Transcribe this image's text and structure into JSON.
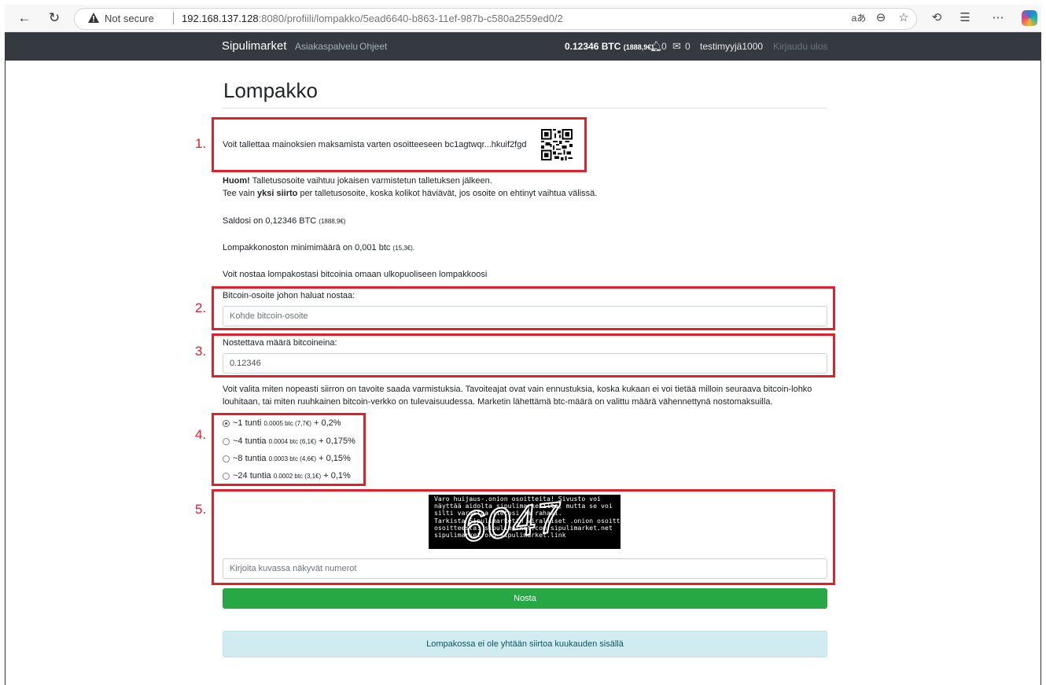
{
  "browser": {
    "not_secure": "Not secure",
    "url_host": "192.168.137.128",
    "url_rest": ":8080/profiili/lompakko/5ead6640-b863-11ef-987b-c580a2559ed0/2"
  },
  "site_nav": {
    "brand": "Sipulimarket",
    "link_customer_service": "Asiakaspalvelu",
    "link_help": "Ohjeet",
    "balance_btc": "0.12346 BTC",
    "balance_eur": "(1888,9€)",
    "notifications_count": "0",
    "messages_count": "0",
    "username": "testimyyjä1000",
    "logout": "Kirjaudu ulos"
  },
  "page": {
    "title": "Lompakko"
  },
  "annotations": {
    "n1": "1.",
    "n2": "2.",
    "n3": "3.",
    "n4": "4.",
    "n5": "5.",
    "color": "#e0202a"
  },
  "deposit": {
    "text": "Voit tallettaa mainoksien maksamista varten osoitteeseen bc1agtwqr...hkuif2fgd"
  },
  "notice": {
    "bold1": "Huom!",
    "line1_rest": " Talletusosoite vaihtuu jokaisen varmistetun talletuksen jälkeen.",
    "line2_a": "Tee vain ",
    "line2_bold": "yksi siirto",
    "line2_b": " per talletusosoite, koska kolikot häviävät, jos osoite on ehtinyt vaihtua välissä."
  },
  "balance": {
    "text": "Saldosi on 0,12346 BTC",
    "eur": "(1888,9€)"
  },
  "minimum": {
    "text": "Lompakkonoston minimimäärä on 0,001 btc",
    "eur": "(15,3€)."
  },
  "withdraw_intro": "Voit nostaa lompakostasi bitcoinia omaan ulkopuoliseen lompakkoosi",
  "address_field": {
    "label": "Bitcoin-osoite johon haluat nostaa:",
    "placeholder": "Kohde bitcoin-osoite"
  },
  "amount_field": {
    "label": "Nostettava määrä bitcoineina:",
    "value": "0.12346"
  },
  "speed_info": {
    "line1": "Voit valita miten nopeasti siirron on tavoite saada varmistuksia. Tavoiteajat ovat vain ennustuksia, koska kukaan ei voi tietää milloin seuraava bitcoin-lohko",
    "line2": "louhitaan, tai miten ruuhkainen bitcoin-verkko on tulevaisuudessa. Marketin lähettämä btc-määrä on valittu määrä vähennettynä nostomaksuilla."
  },
  "speed_options": [
    {
      "label": "~1 tunti",
      "fee": "0.0005 btc (7,7€)",
      "pct": "+ 0,2%",
      "checked": true
    },
    {
      "label": "~4 tuntia",
      "fee": "0.0004 btc (6,1€)",
      "pct": "+ 0,175%",
      "checked": false
    },
    {
      "label": "~8 tuntia",
      "fee": "0.0003 btc (4,6€)",
      "pct": "+ 0,15%",
      "checked": false
    },
    {
      "label": "~24 tuntia",
      "fee": "0.0002 btc (3,1€)",
      "pct": "+ 0,1%",
      "checked": false
    }
  ],
  "captcha": {
    "code": "6047",
    "lines": [
      "Varo huijaus-.onion osoitteita! Sivusto voi",
      "näyttää aidolta sipulimarketilta, mutta se voi",
      "silti varastaa tietosi ja rahasi.",
      "Tarkista Sipulimarketin viralliset .onion osoitteet",
      "osoitteesta: sipulimarket.com sipulimarket.net",
      "sipulimarket.org sipulimarket.link"
    ],
    "input_placeholder": "Kirjoita kuvassa näkyvät numerot"
  },
  "submit_label": "Nosta",
  "alert_text": "Lompakossa ei ole yhtään siirtoa kuukauden sisällä",
  "colors": {
    "navbar": "#343a40",
    "button": "#28a745",
    "alert_bg": "#d1ecf1",
    "alert_text": "#0c5460"
  }
}
